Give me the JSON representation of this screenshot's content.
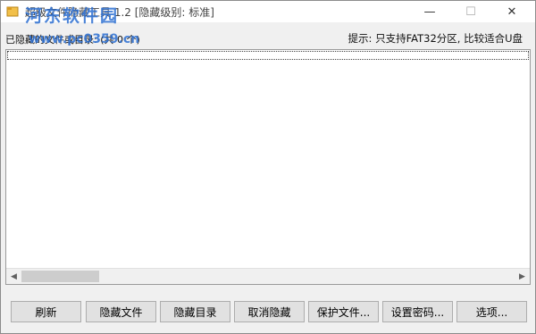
{
  "window": {
    "title": "超级文件隐藏工具 1.2 [隐藏级别: 标准]",
    "controls": {
      "minimize": "—",
      "maximize": "☐",
      "close": "✕"
    }
  },
  "watermark": {
    "main": "河东软件园",
    "sub": "www.pc0359.cn"
  },
  "info": {
    "list_label": "已隐藏的文件或目录: (共 0 个)",
    "tip": "提示: 只支持FAT32分区, 比较适合U盘"
  },
  "listbox": {
    "items": []
  },
  "scrollbar": {
    "left_arrow": "◀",
    "right_arrow": "▶"
  },
  "buttons": {
    "refresh": "刷新",
    "hide_file": "隐藏文件",
    "hide_dir": "隐藏目录",
    "unhide": "取消隐藏",
    "protect": "保护文件...",
    "set_password": "设置密码...",
    "options": "选项..."
  },
  "colors": {
    "desktop": "#4e7a2e",
    "window_bg": "#f0f0f0",
    "watermark": "#2c6fd2"
  }
}
